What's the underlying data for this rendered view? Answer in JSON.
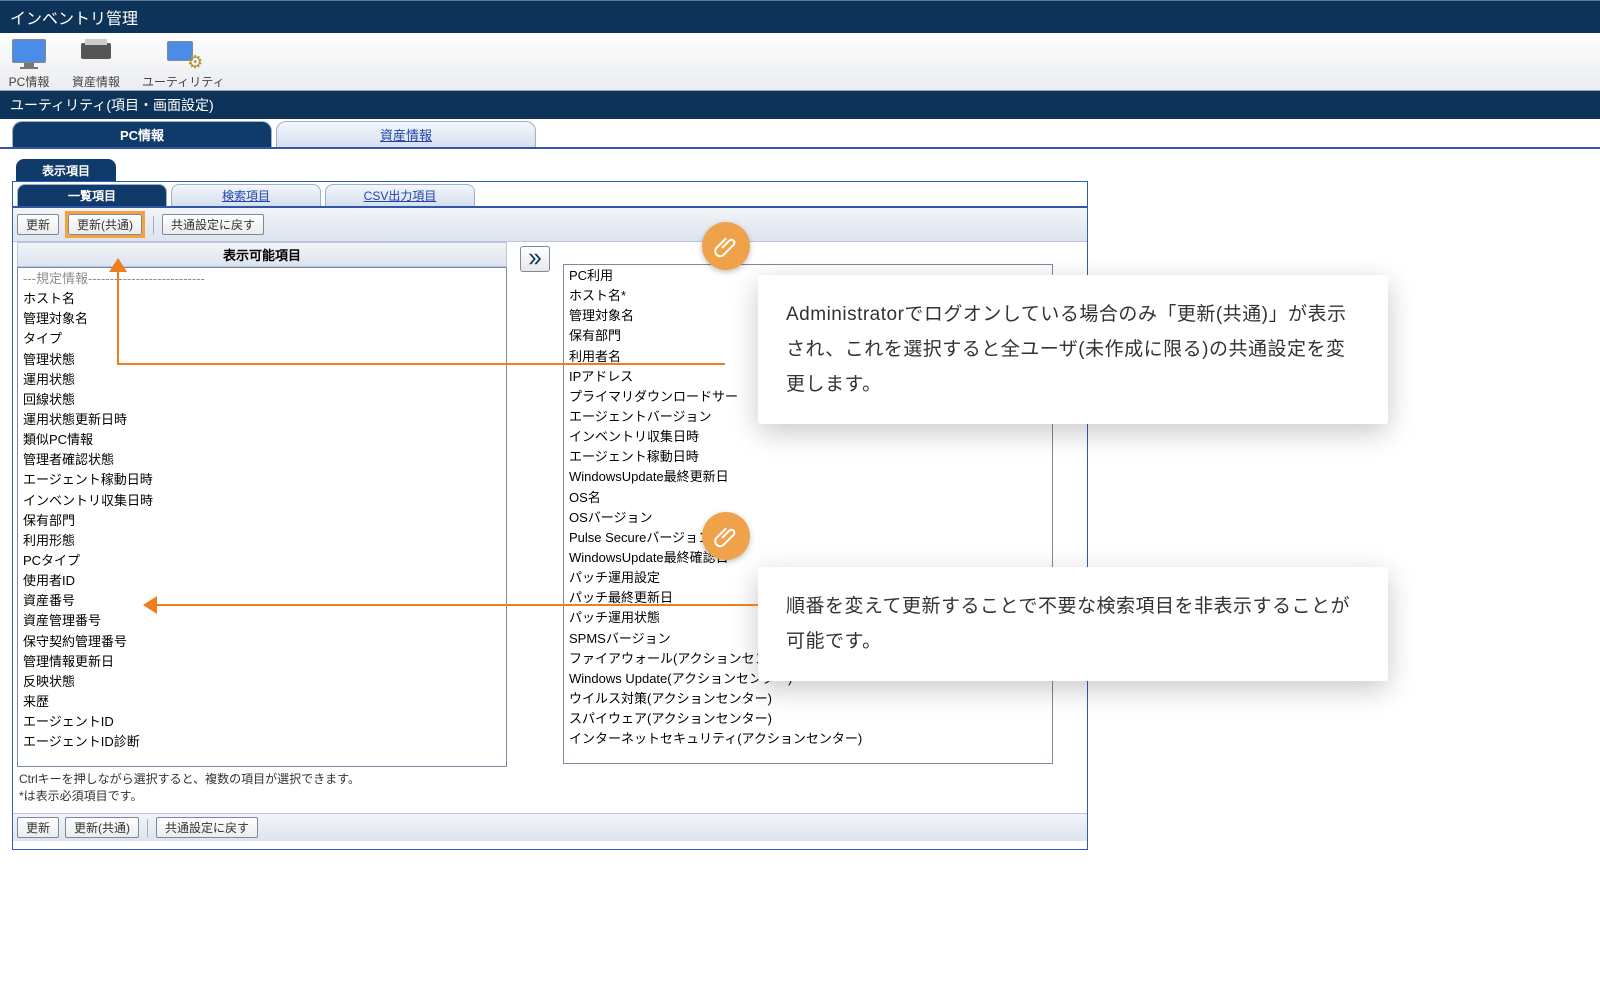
{
  "titlebar": {
    "title": "インベントリ管理"
  },
  "toolbar": {
    "items": [
      {
        "label": "PC情報",
        "icon": "monitor"
      },
      {
        "label": "資産情報",
        "icon": "printer"
      },
      {
        "label": "ユーティリティ",
        "icon": "util"
      }
    ]
  },
  "subheader": {
    "title": "ユーティリティ(項目・画面設定)"
  },
  "page_tabs": {
    "active": "PC情報",
    "items": [
      "PC情報",
      "資産情報"
    ]
  },
  "display_tab": {
    "label": "表示項目"
  },
  "inner_tabs": {
    "active": "一覧項目",
    "items": [
      "一覧項目",
      "検索項目",
      "CSV出力項目"
    ]
  },
  "actions": {
    "update": "更新",
    "update_common": "更新(共通)",
    "revert_common": "共通設定に戻す"
  },
  "left_list_header": "表示可能項目",
  "left_items": [
    "---規定情報---------------------------",
    "ホスト名",
    "管理対象名",
    "タイプ",
    "管理状態",
    "運用状態",
    "回線状態",
    "運用状態更新日時",
    "類似PC情報",
    "管理者確認状態",
    "エージェント稼動日時",
    "インベントリ収集日時",
    "保有部門",
    "利用形態",
    "PCタイプ",
    "使用者ID",
    "資産番号",
    "資産管理番号",
    "保守契約管理番号",
    "管理情報更新日",
    "反映状態",
    "来歴",
    "エージェントID",
    "エージェントID診断"
  ],
  "right_items": [
    "PC利用",
    "ホスト名*",
    "管理対象名",
    "保有部門",
    "利用者名",
    "IPアドレス",
    "プライマリダウンロードサー",
    "エージェントバージョン",
    "インベントリ収集日時",
    "エージェント稼動日時",
    "WindowsUpdate最終更新日",
    "OS名",
    "OSバージョン",
    "Pulse Secureバージョン",
    "WindowsUpdate最終確認日",
    "パッチ運用設定",
    "パッチ最終更新日",
    "パッチ運用状態",
    "SPMSバージョン",
    "ファイアウォール(アクションセンター)",
    "Windows Update(アクションセンター)",
    "ウイルス対策(アクションセンター)",
    "スパイウェア(アクションセンター)",
    "インターネットセキュリティ(アクションセンター)"
  ],
  "footnotes": {
    "line1": "Ctrlキーを押しながら選択すると、複数の項目が選択できます。",
    "line2": "*は表示必須項目です。"
  },
  "annotations": {
    "top": "Administratorでログオンしている場合のみ「更新(共通)」が表示され、これを選択すると全ユーザ(未作成に限る)の共通設定を変更します。",
    "bottom": "順番を変えて更新することで不要な検索項目を非表示することが可能です。"
  },
  "colors": {
    "header_blue": "#0d3359",
    "accent_orange": "#f0a24b",
    "arrow_orange": "#ef7f1e",
    "tab_active": "#103a6a"
  }
}
